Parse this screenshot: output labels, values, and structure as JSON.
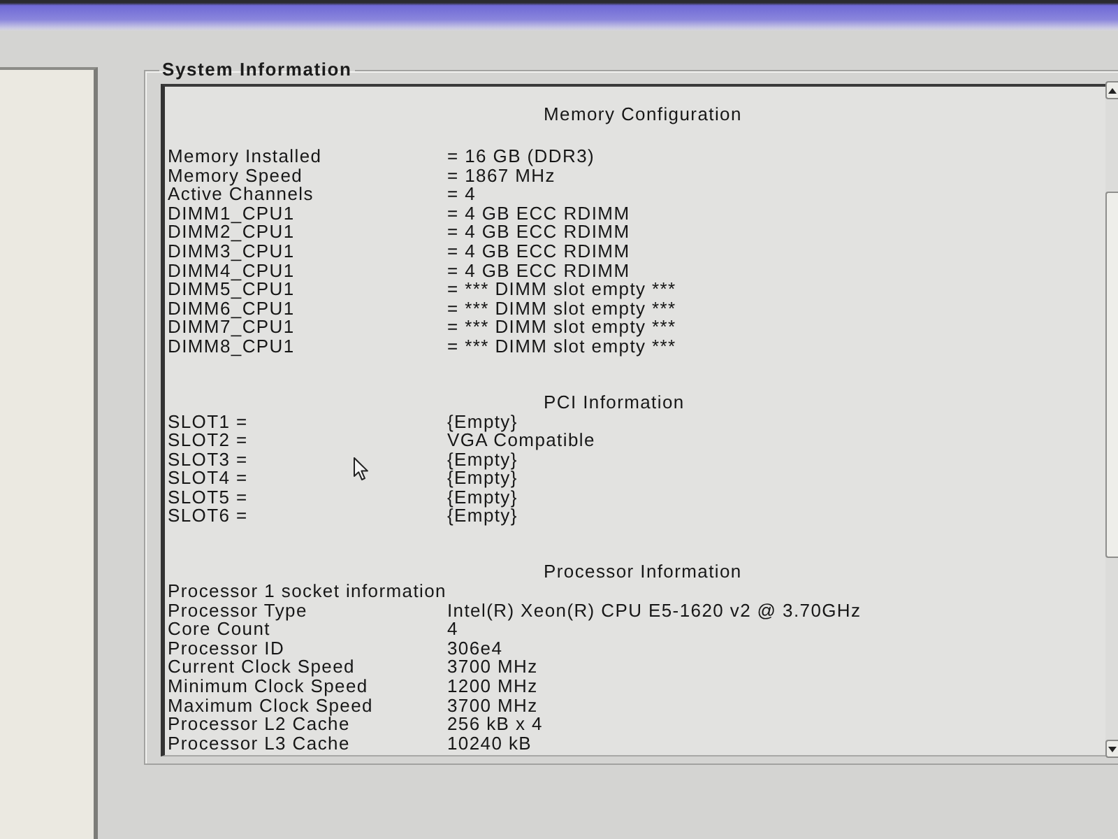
{
  "group_title": "System Information",
  "sections": [
    {
      "title": "Memory Configuration",
      "rows": [
        {
          "label": "Memory Installed",
          "value": "= 16 GB (DDR3)"
        },
        {
          "label": "Memory Speed",
          "value": "= 1867 MHz"
        },
        {
          "label": "Active Channels",
          "value": "= 4"
        },
        {
          "label": "DIMM1_CPU1",
          "value": "= 4 GB ECC RDIMM"
        },
        {
          "label": "DIMM2_CPU1",
          "value": "= 4 GB ECC RDIMM"
        },
        {
          "label": "DIMM3_CPU1",
          "value": "= 4 GB ECC RDIMM"
        },
        {
          "label": "DIMM4_CPU1",
          "value": "= 4 GB ECC RDIMM"
        },
        {
          "label": "DIMM5_CPU1",
          "value": "= *** DIMM slot empty ***"
        },
        {
          "label": "DIMM6_CPU1",
          "value": "= *** DIMM slot empty ***"
        },
        {
          "label": "DIMM7_CPU1",
          "value": "= *** DIMM slot empty ***"
        },
        {
          "label": "DIMM8_CPU1",
          "value": "= *** DIMM slot empty ***"
        }
      ]
    },
    {
      "title": "PCI Information",
      "rows": [
        {
          "label": "SLOT1 =",
          "value": "{Empty}"
        },
        {
          "label": "SLOT2 =",
          "value": "VGA Compatible"
        },
        {
          "label": "SLOT3 =",
          "value": "{Empty}"
        },
        {
          "label": "SLOT4 =",
          "value": "{Empty}"
        },
        {
          "label": "SLOT5 =",
          "value": "{Empty}"
        },
        {
          "label": "SLOT6 =",
          "value": "{Empty}"
        }
      ]
    },
    {
      "title": "Processor Information",
      "subheading": "Processor 1 socket information",
      "rows": [
        {
          "label": "Processor Type",
          "value": "Intel(R) Xeon(R) CPU E5-1620 v2 @ 3.70GHz"
        },
        {
          "label": "Core Count",
          "value": "4"
        },
        {
          "label": "Processor ID",
          "value": "306e4"
        },
        {
          "label": "Current Clock Speed",
          "value": "3700 MHz"
        },
        {
          "label": "Minimum Clock Speed",
          "value": "1200 MHz"
        },
        {
          "label": "Maximum Clock Speed",
          "value": "3700 MHz"
        },
        {
          "label": "Processor L2 Cache",
          "value": "256 kB x 4"
        },
        {
          "label": "Processor L3 Cache",
          "value": "10240 kB"
        }
      ]
    }
  ]
}
